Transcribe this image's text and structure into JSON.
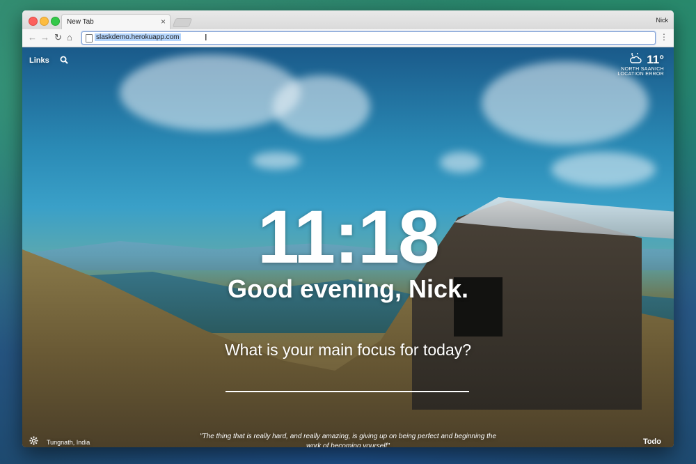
{
  "browser": {
    "tab_title": "New Tab",
    "tab_close": "×",
    "profile_name": "Nick",
    "url": "slaskdemo.herokuapp.com",
    "nav": {
      "back": "←",
      "forward": "→",
      "reload": "↻",
      "home": "⌂",
      "menu": "⋮"
    }
  },
  "page": {
    "links_label": "Links",
    "weather": {
      "temperature": "11°",
      "location": "NORTH SAANICH",
      "status": "LOCATION ERROR",
      "icon": "partly-cloudy-night-icon"
    },
    "clock": "11:18",
    "greeting": "Good evening, Nick.",
    "focus_prompt": "What is your main focus for today?",
    "photo_location": "Tungnath, India",
    "quote": "\"The thing that is really hard, and really amazing, is giving up on being perfect and beginning the work of becoming yourself\"",
    "todo_label": "Todo"
  },
  "colors": {
    "accent": "#ffffff",
    "omnibox_border": "#8aa6d6"
  }
}
